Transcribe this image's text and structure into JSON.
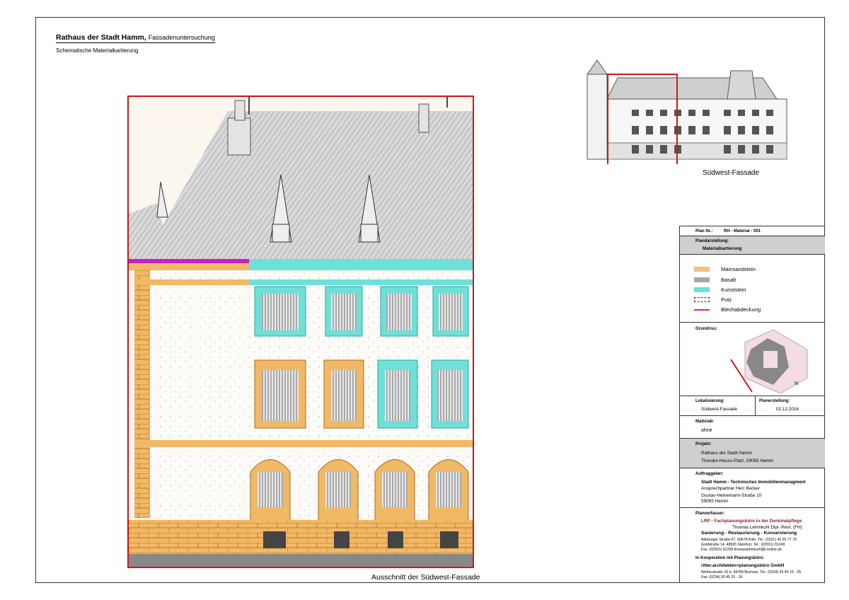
{
  "header": {
    "title": "Rathaus der Stadt Hamm,",
    "title_suffix": "Fassadenuntersuchung",
    "subtitle": "Schematische Materialkartierung"
  },
  "main_figure": {
    "caption": "Ausschnitt der Südwest-Fassade"
  },
  "overview": {
    "caption": "Südwest-Fassade"
  },
  "title_block": {
    "plan_nr_label": "Plan Nr.:",
    "plan_nr_value": "RH - Material - 001",
    "plandarstellung_label": "Plandarstellung:",
    "plandarstellung_value": "Materialkartierung",
    "legend": [
      {
        "label": "Mainsandstein",
        "color": "#f4c07a",
        "kind": "fill"
      },
      {
        "label": "Basalt",
        "color": "#a8a8a8",
        "kind": "fill"
      },
      {
        "label": "Kunststein",
        "color": "#6ee0d8",
        "kind": "fill"
      },
      {
        "label": "Putz",
        "color": "#ffffff",
        "kind": "dotted"
      },
      {
        "label": "Blechabdeckung",
        "color": "#c81fc8",
        "kind": "line"
      }
    ],
    "grundriss_label": "Grundriss:",
    "lokalisierung_label": "Lokalisierung:",
    "lokalisierung_value": "Südwest-Fassade",
    "planerstellung_label": "Planerstellung:",
    "planerstellung_value": "02.12.2016",
    "massstab_label": "Maßstab:",
    "massstab_value": "ohne",
    "projekt_label": "Projekt:",
    "projekt_name": "Rathaus der Stadt Hamm",
    "projekt_address": "Theodor-Heuss-Platz, 59065 Hamm",
    "auftraggeber_label": "Auftraggeber:",
    "auftraggeber_name": "Stadt Hamm - Technisches Immobilienmanagment",
    "auftraggeber_contact": "Ansprechpartner Herr Becker",
    "auftraggeber_street": "Gustav-Heinemann-Straße 10",
    "auftraggeber_city": "59065 Hamm",
    "planverfasser_label": "Planverfasser:",
    "planverfasser_firm": "LRP - Fachplanungsbüro in der Denkmalpflege",
    "planverfasser_person": "Thomas Lehmkuhl Dipl.-Rest. (FH)",
    "planverfasser_services": "Sanierung  -  Restaurierung  -  Konservierung",
    "planverfasser_addr1": "Alteburger Straße 67, 50678 Köln,    Tel.: (0221) 42 03 77 70",
    "planverfasser_addr2": "Goldstraße 14, 48565 Steinfurt, Tel.: (02551) 81249",
    "planverfasser_addr3": "Fax:        (02551)       81259       thomaslehmkuhl@t-online.de",
    "kooperation_label": "In Kooperation mit Planungsbüro:",
    "kooperation_firm": "ritter.architekten+planungsbüro GmbH",
    "kooperation_addr1": "Weiherstraße 20 b, 44789 Bochum, Tel.: (0234) 93 45 15 - 25",
    "kooperation_addr2": "Fax: (0234) 93 45 15 - 26"
  }
}
